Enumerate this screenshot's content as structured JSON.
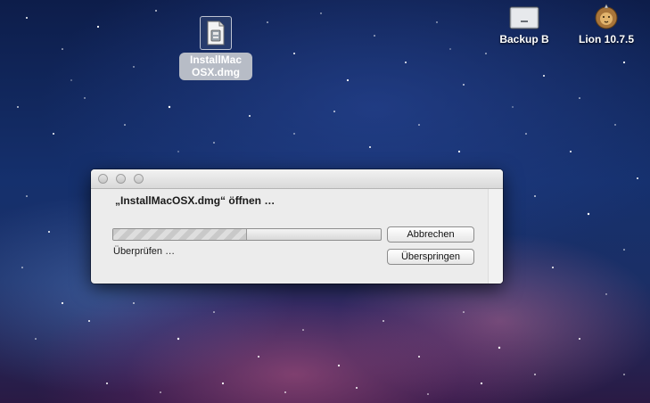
{
  "desktop": {
    "icons": [
      {
        "label": "InstallMac OSX.dmg",
        "icon": "disk-image-icon"
      },
      {
        "label": "Backup B",
        "icon": "external-drive-icon"
      },
      {
        "label": "Lion 10.7.5",
        "icon": "lion-installer-icon"
      }
    ]
  },
  "dialog": {
    "title": "„InstallMacOSX.dmg“ öffnen …",
    "progress_fraction": 0.5,
    "status": "Überprüfen …",
    "cancel_label": "Abbrechen",
    "skip_label": "Überspringen"
  },
  "colors": {
    "dialog_bg": "#ececec",
    "selected_label_bg": "#b7bcc6"
  }
}
